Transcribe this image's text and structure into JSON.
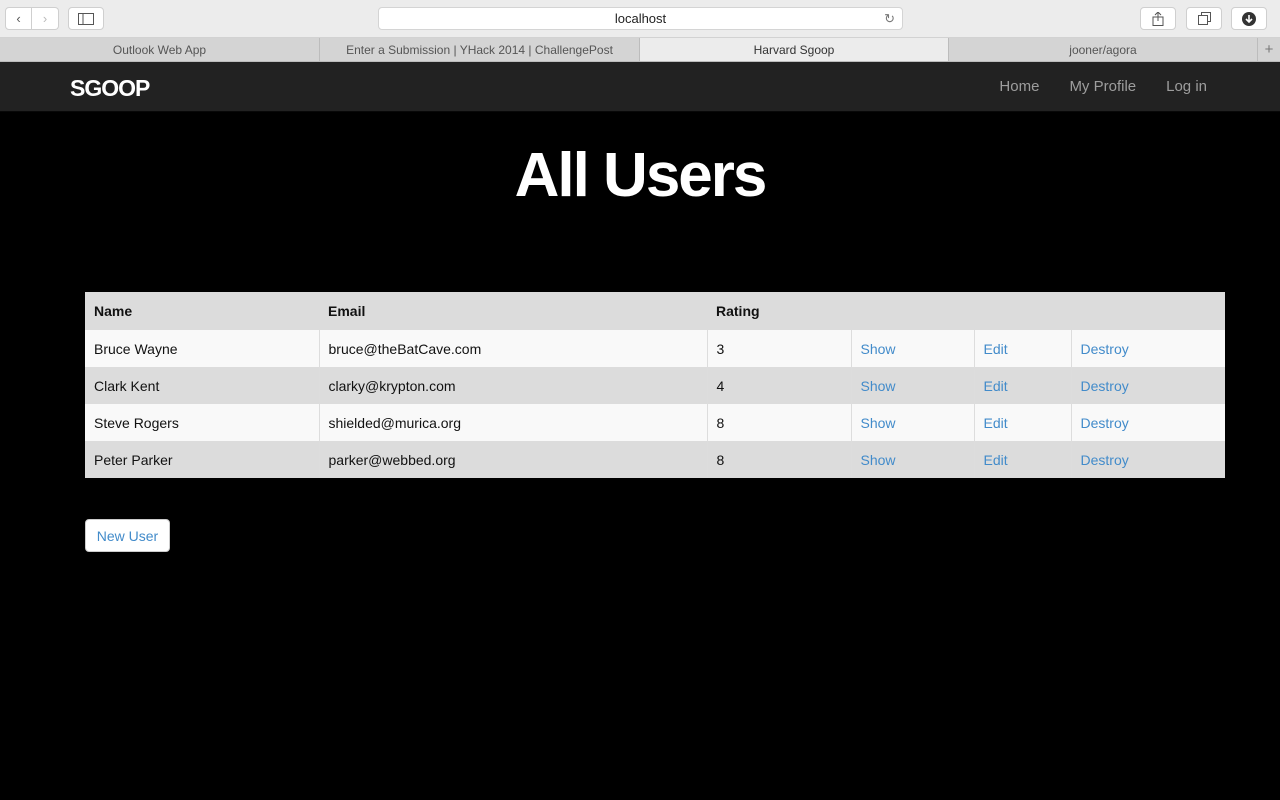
{
  "browser": {
    "url": "localhost",
    "tabs": [
      {
        "label": "Outlook Web App",
        "active": false
      },
      {
        "label": "Enter a Submission | YHack 2014 | ChallengePost",
        "active": false
      },
      {
        "label": "Harvard Sgoop",
        "active": true
      },
      {
        "label": "jooner/agora",
        "active": false
      }
    ]
  },
  "navbar": {
    "brand": "SGOOP",
    "links": [
      "Home",
      "My Profile",
      "Log in"
    ]
  },
  "page": {
    "title": "All Users",
    "new_user_label": "New User"
  },
  "table": {
    "headers": [
      "Name",
      "Email",
      "Rating"
    ],
    "rows": [
      {
        "name": "Bruce Wayne",
        "email": "bruce@theBatCave.com",
        "rating": "3",
        "show": "Show",
        "edit": "Edit",
        "destroy": "Destroy"
      },
      {
        "name": "Clark Kent",
        "email": "clarky@krypton.com",
        "rating": "4",
        "show": "Show",
        "edit": "Edit",
        "destroy": "Destroy"
      },
      {
        "name": "Steve Rogers",
        "email": "shielded@murica.org",
        "rating": "8",
        "show": "Show",
        "edit": "Edit",
        "destroy": "Destroy"
      },
      {
        "name": "Peter Parker",
        "email": "parker@webbed.org",
        "rating": "8",
        "show": "Show",
        "edit": "Edit",
        "destroy": "Destroy"
      }
    ]
  },
  "colors": {
    "link": "#428bca",
    "navbar": "#222222",
    "background": "#000000"
  }
}
